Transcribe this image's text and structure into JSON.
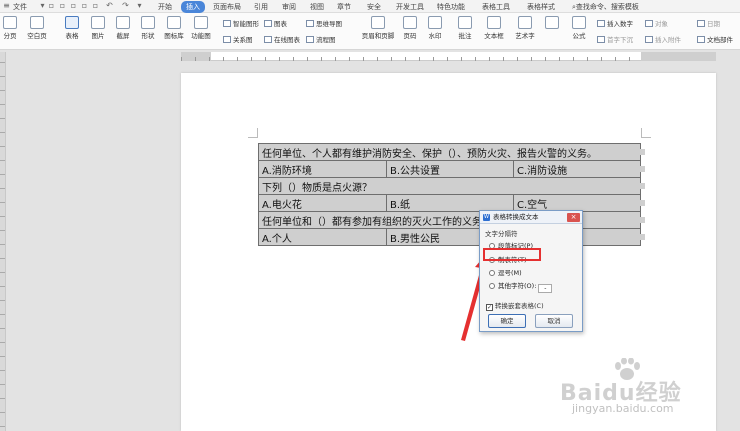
{
  "menu": {
    "file": "文件",
    "items": [
      "开始",
      "插入",
      "页面布局",
      "引用",
      "审阅",
      "视图",
      "章节",
      "安全",
      "开发工具",
      "特色功能",
      "表格工具",
      "表格样式"
    ],
    "active": "插入",
    "search": "查找命令、搜索模板"
  },
  "ribbon": {
    "page_break": "分页",
    "blank_page": "空白页",
    "table": "表格",
    "picture": "图片",
    "screenshot": "截屏",
    "shape": "形状",
    "icon_lib": "图标库",
    "func_chart": "功能图",
    "smart_shape": "智能图形",
    "chart": "图表",
    "mind_map": "思维导图",
    "relation": "关系图",
    "online_chart": "在线图表",
    "flowchart": "流程图",
    "header_footer": "页眉和页脚",
    "page_number": "页码",
    "watermark": "水印",
    "comment": "批注",
    "textbox": "文本框",
    "wordart": "艺术字",
    "formula": "公式",
    "insert_number": "插入数字",
    "object": "对象",
    "date": "日期",
    "dropcap": "首字下沉",
    "attachment": "插入附件",
    "doc_parts": "文档部件"
  },
  "table": {
    "rows": [
      {
        "type": "full",
        "cells": [
          "任何单位、个人都有维护消防安全、保护（）、预防火灾、报告火警的义务。"
        ]
      },
      {
        "type": "split",
        "cells": [
          "A.消防环境",
          "B.公共设置",
          "C.消防设施"
        ]
      },
      {
        "type": "full",
        "cells": [
          "下列（）物质是点火源？"
        ]
      },
      {
        "type": "split",
        "cells": [
          "A.电火花",
          "B.纸",
          "C.空气"
        ]
      },
      {
        "type": "full",
        "cells": [
          "任何单位和（）都有参加有组织的灭火工作的义务。"
        ]
      },
      {
        "type": "split",
        "cells": [
          "A.个人",
          "B.男性公民",
          ""
        ]
      }
    ]
  },
  "dialog": {
    "title": "表格转换成文本",
    "group_label": "文字分隔符",
    "options": [
      {
        "label": "段落标记(P)",
        "checked": false
      },
      {
        "label": "制表符(T)",
        "checked": true
      },
      {
        "label": "逗号(M)",
        "checked": false
      },
      {
        "label": "其他字符(O):",
        "checked": false
      }
    ],
    "other_value": "-",
    "nested_checkbox": "转换嵌套表格(C)",
    "nested_checked": true,
    "ok": "确定",
    "cancel": "取消"
  },
  "watermark": {
    "brand": "Baidu经验",
    "url": "jingyan.baidu.com"
  },
  "colors": {
    "accent": "#4a86d9",
    "highlight": "#e53030",
    "arrow": "#e53030",
    "table_fill": "#cfcfcf"
  }
}
